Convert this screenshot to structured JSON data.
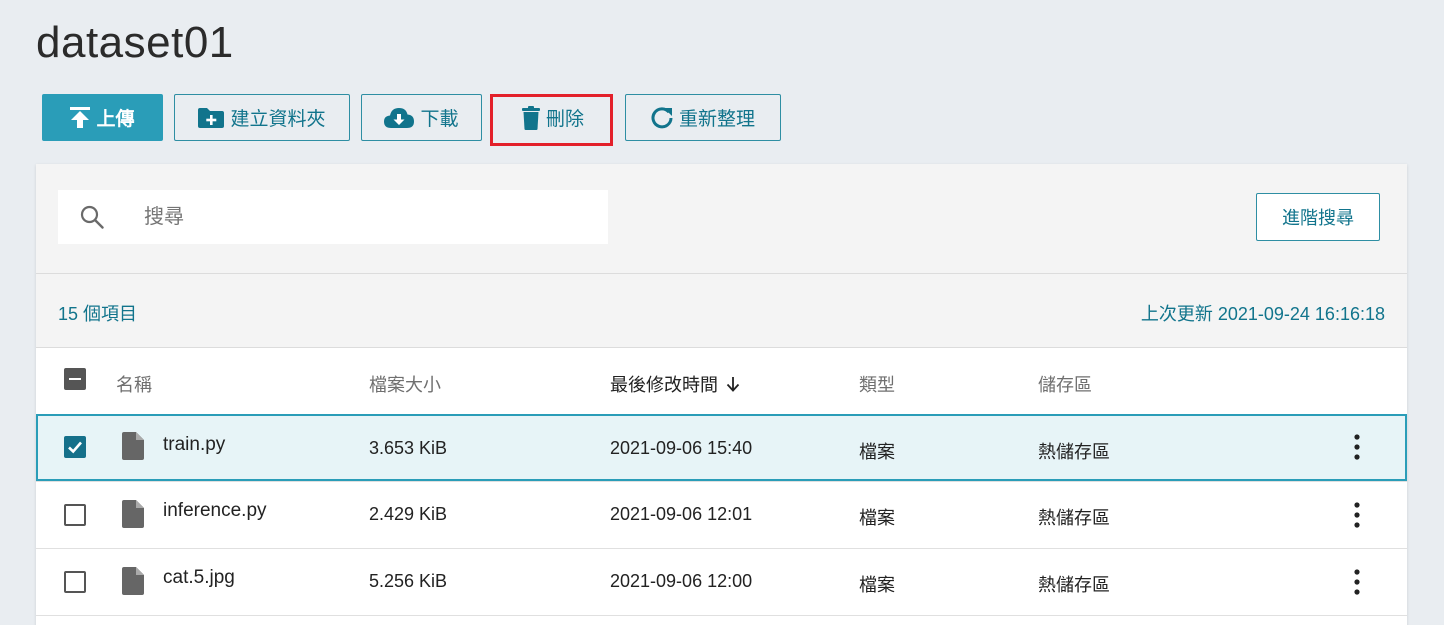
{
  "page": {
    "title": "dataset01"
  },
  "toolbar": {
    "upload_label": "上傳",
    "new_folder_label": "建立資料夾",
    "download_label": "下載",
    "delete_label": "刪除",
    "refresh_label": "重新整理"
  },
  "search": {
    "placeholder": "搜尋",
    "advanced_label": "進階搜尋"
  },
  "info": {
    "item_count": "15 個項目",
    "last_updated": "上次更新 2021-09-24 16:16:18"
  },
  "table": {
    "columns": {
      "name": "名稱",
      "size": "檔案大小",
      "modified": "最後修改時間",
      "type": "類型",
      "storage": "儲存區"
    },
    "rows": [
      {
        "name": "train.py",
        "size": "3.653 KiB",
        "modified": "2021-09-06 15:40",
        "type": "檔案",
        "storage": "熱儲存區",
        "checked": true
      },
      {
        "name": "inference.py",
        "size": "2.429 KiB",
        "modified": "2021-09-06 12:01",
        "type": "檔案",
        "storage": "熱儲存區",
        "checked": false
      },
      {
        "name": "cat.5.jpg",
        "size": "5.256 KiB",
        "modified": "2021-09-06 12:00",
        "type": "檔案",
        "storage": "熱儲存區",
        "checked": false
      }
    ]
  },
  "colors": {
    "accent": "#2a9db8",
    "text_accent": "#11748c",
    "highlight": "#e3202a"
  }
}
